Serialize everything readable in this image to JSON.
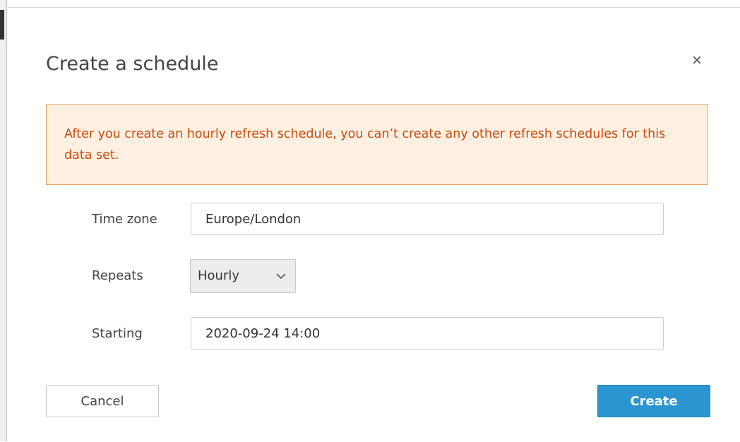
{
  "dialog": {
    "title": "Create a schedule",
    "close_icon": "close-icon",
    "close_glyph": "×"
  },
  "warning": {
    "text": "After you create an hourly refresh schedule, you can’t create any other refresh schedules for this data set.",
    "text_color": "#cc4a0f",
    "background": "#fdf0e1",
    "border_color": "#e8a463"
  },
  "form": {
    "time_zone": {
      "label": "Time zone",
      "value": "Europe/London"
    },
    "repeats": {
      "label": "Repeats",
      "selected": "Hourly",
      "icon": "chevron-down-icon"
    },
    "starting": {
      "label": "Starting",
      "value": "2020-09-24 14:00"
    }
  },
  "actions": {
    "cancel_label": "Cancel",
    "create_label": "Create",
    "create_color": "#2b95d1"
  }
}
